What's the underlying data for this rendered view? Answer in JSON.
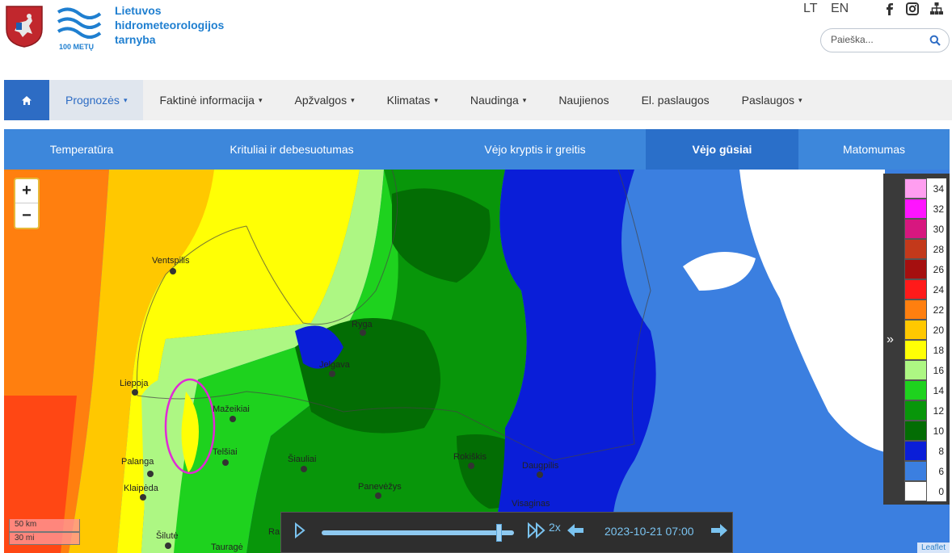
{
  "header": {
    "org_line1": "Lietuvos",
    "org_line2": "hidrometeorologijos",
    "org_line3": "tarnyba",
    "anniversary": "100 METŲ",
    "lang_lt": "LT",
    "lang_en": "EN",
    "search_placeholder": "Paieška..."
  },
  "nav": {
    "items": [
      {
        "label": "Prognozės",
        "dropdown": true,
        "active": true
      },
      {
        "label": "Faktinė informacija",
        "dropdown": true
      },
      {
        "label": "Apžvalgos",
        "dropdown": true
      },
      {
        "label": "Klimatas",
        "dropdown": true
      },
      {
        "label": "Naudinga",
        "dropdown": true
      },
      {
        "label": "Naujienos",
        "dropdown": false
      },
      {
        "label": "El. paslaugos",
        "dropdown": false
      },
      {
        "label": "Paslaugos",
        "dropdown": true
      }
    ]
  },
  "subnav": {
    "items": [
      {
        "label": "Temperatūra"
      },
      {
        "label": "Krituliai ir debesuotumas"
      },
      {
        "label": "Vėjo kryptis ir greitis"
      },
      {
        "label": "Vėjo gūsiai",
        "active": true
      },
      {
        "label": "Matomumas"
      }
    ]
  },
  "map": {
    "zoom_in": "+",
    "zoom_out": "−",
    "scale_km": "50 km",
    "scale_mi": "30 mi",
    "attribution": "Leaflet",
    "cities": [
      "Ventspilis",
      "Ryga",
      "Jelgava",
      "Liepoja",
      "Mažeikiai",
      "Telšiai",
      "Šiauliai",
      "Palanga",
      "Klaipėda",
      "Rokiškis",
      "Daugpilis",
      "Panevėžys",
      "Visaginas",
      "Šilutė",
      "Tauragė",
      "Ra"
    ]
  },
  "player": {
    "speed": "2x",
    "timestamp": "2023-10-21 07:00",
    "progress": 0.92
  },
  "legend": {
    "unit_values": [
      "34",
      "32",
      "30",
      "28",
      "26",
      "24",
      "22",
      "20",
      "18",
      "16",
      "14",
      "12",
      "10",
      "8",
      "6",
      "0"
    ],
    "colors": [
      "#ff9ef0",
      "#ff14ff",
      "#d7177f",
      "#c3391b",
      "#a50f0f",
      "#ff1a1a",
      "#ff7f0f",
      "#ffc800",
      "#ffff05",
      "#adf783",
      "#1ed21e",
      "#08960a",
      "#036d04",
      "#0a1ed8",
      "#3b7fe0",
      "#ffffff"
    ]
  },
  "colors": {
    "accent": "#2d6cc4",
    "subnav": "#3d87db",
    "logo": "#1f7fd0"
  }
}
